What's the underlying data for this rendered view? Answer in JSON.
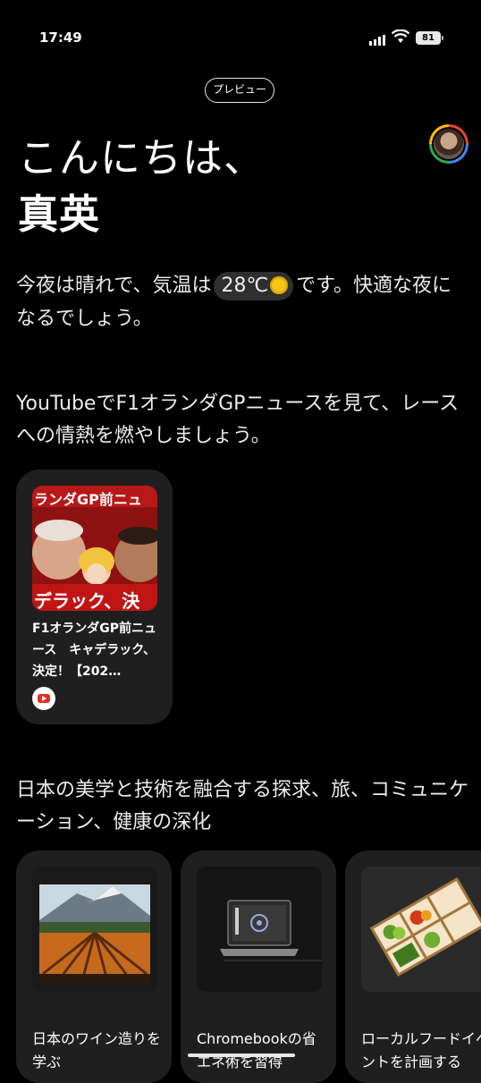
{
  "status_bar": {
    "time": "17:49",
    "battery": "81"
  },
  "header": {
    "preview_label": "プレビュー"
  },
  "greeting": {
    "line1": "こんにちは、",
    "line2": "真英"
  },
  "weather": {
    "before": "今夜は晴れで、気温は",
    "temp": "28℃",
    "after": "です。快適な夜になるでしょう。"
  },
  "youtube_section": {
    "title": "YouTubeでF1オランダGPニュースを見て、レースへの情熱を燃やしましょう。",
    "card": {
      "title": "F1オランダGP前ニュース　キャデラック、決定！【202…",
      "thumb_top_text": "ランダGP前ニュ",
      "thumb_bottom_text": "デラック、決"
    }
  },
  "interests_section": {
    "title": "日本の美学と技術を融合する探求、旅、コミュニケーション、健康の深化",
    "cards": [
      {
        "title": "日本のワイン造りを学ぶ",
        "icon": "vineyard-image"
      },
      {
        "title": "Chromebookの省エネ術を習得",
        "icon": "laptop-image"
      },
      {
        "title": "ローカルフードイベントを計画する",
        "icon": "food-tray-image"
      }
    ]
  },
  "colors": {
    "background": "#000000",
    "card": "#1f1f1f",
    "chip": "#2f2f2f"
  }
}
